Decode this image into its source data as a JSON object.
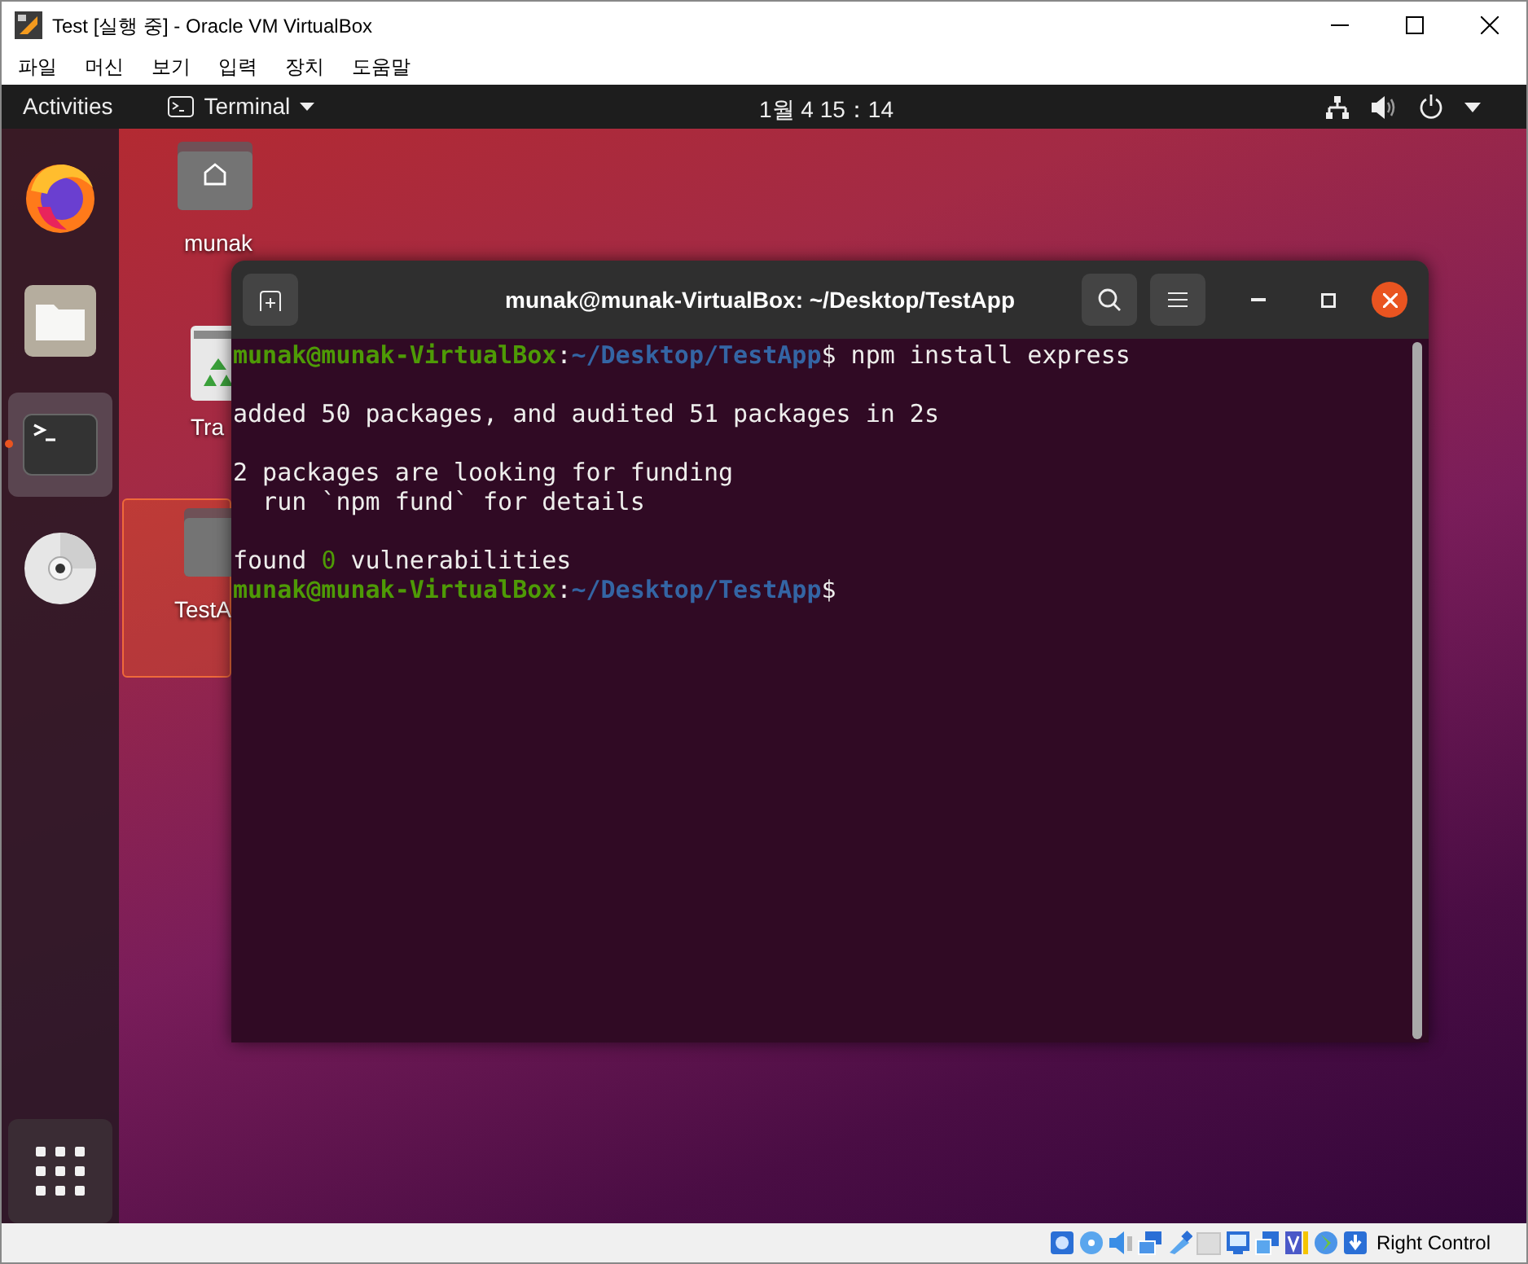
{
  "vbox_window": {
    "title": "Test [실행 중] - Oracle VM VirtualBox"
  },
  "menu": [
    "파일",
    "머신",
    "보기",
    "입력",
    "장치",
    "도움말"
  ],
  "top_bar": {
    "activities": "Activities",
    "app_menu": "Terminal",
    "clock": "1월 4  15：14"
  },
  "dock": [
    {
      "kind": "firefox",
      "running": false,
      "selected": false
    },
    {
      "kind": "files",
      "running": false,
      "selected": false
    },
    {
      "kind": "terminal",
      "running": true,
      "selected": true
    },
    {
      "kind": "disc",
      "running": false,
      "selected": false
    }
  ],
  "desktop_icons": [
    {
      "kind": "home-folder",
      "label": "munak",
      "selected": false
    },
    {
      "kind": "trash",
      "label": "Tra",
      "selected": false
    },
    {
      "kind": "folder",
      "label": "TestA",
      "selected": true
    }
  ],
  "terminal": {
    "title": "munak@munak-VirtualBox: ~/Desktop/TestApp",
    "lines": [
      {
        "kind": "text",
        "segments": [
          {
            "kind": "user",
            "text": "munak@munak-VirtualBox"
          },
          {
            "kind": "plain",
            "text": ":"
          },
          {
            "kind": "path",
            "text": "~/Desktop/TestApp"
          },
          {
            "kind": "plain",
            "text": "$ npm install express"
          }
        ]
      },
      {
        "kind": "blank"
      },
      {
        "kind": "text",
        "segments": [
          {
            "kind": "plain",
            "text": "added 50 packages, and audited 51 packages in 2s"
          }
        ]
      },
      {
        "kind": "blank"
      },
      {
        "kind": "text",
        "segments": [
          {
            "kind": "plain",
            "text": "2 packages are looking for funding"
          }
        ]
      },
      {
        "kind": "text",
        "segments": [
          {
            "kind": "plain",
            "text": "  run `npm fund` for details"
          }
        ]
      },
      {
        "kind": "blank"
      },
      {
        "kind": "text",
        "segments": [
          {
            "kind": "plain",
            "text": "found "
          },
          {
            "kind": "number",
            "text": "0"
          },
          {
            "kind": "plain",
            "text": " vulnerabilities"
          }
        ]
      },
      {
        "kind": "text",
        "segments": [
          {
            "kind": "user",
            "text": "munak@munak-VirtualBox"
          },
          {
            "kind": "plain",
            "text": ":"
          },
          {
            "kind": "path",
            "text": "~/Desktop/TestApp"
          },
          {
            "kind": "plain",
            "text": "$"
          }
        ]
      }
    ]
  },
  "status_bar": {
    "host_key": "Right Control"
  }
}
